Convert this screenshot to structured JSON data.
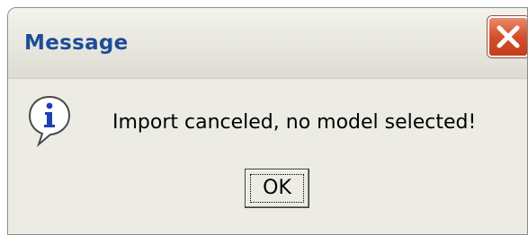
{
  "dialog": {
    "title": "Message",
    "message": "Import canceled, no model selected!",
    "ok_label": "OK",
    "icon": "info-icon",
    "close_icon": "close-icon"
  },
  "colors": {
    "title_text": "#1e4c98",
    "close_button": "#d5502c",
    "dialog_background": "#ecebe4",
    "info_icon_blue": "#1f3fb8"
  }
}
